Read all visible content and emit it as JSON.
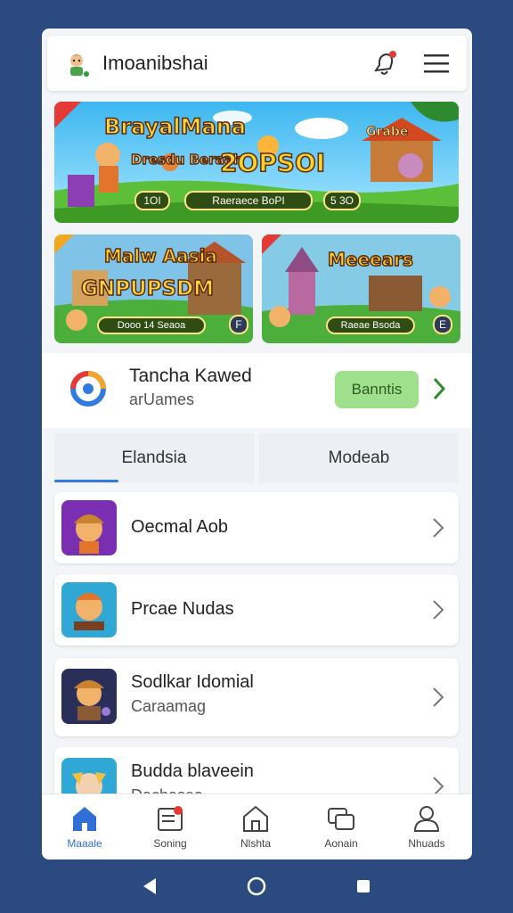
{
  "header": {
    "title": "Imoanibshai",
    "logo_icon": "character-logo-icon",
    "notification_icon": "bell-icon",
    "menu_icon": "hamburger-menu-icon"
  },
  "banner": {
    "title": "BrayalMana",
    "subtitle": "Dresdu Beraah",
    "big_text": "2OPSOI",
    "pill_left": "1OI",
    "pill_mid": "Raeraece BoPI",
    "pill_right": "5 3O",
    "sign": "Grabe"
  },
  "cards": [
    {
      "title": "Malw Aasia",
      "big_text": "GNPUPSDM",
      "pill": "Dooo  14 Seaoa",
      "badge": "F"
    },
    {
      "title": "Meeears",
      "pill": "Raeae Bsoda",
      "badge": "E"
    }
  ],
  "account": {
    "name": "Tancha Kawed",
    "sub": "arUames",
    "button_label": "Banntis"
  },
  "tabs": [
    {
      "label": "Elandsia",
      "active": true
    },
    {
      "label": "Modeab",
      "active": false
    }
  ],
  "list": [
    {
      "title": "Oecmal Aob",
      "sub": ""
    },
    {
      "title": "Prcae Nudas",
      "sub": ""
    },
    {
      "title": "Sodlkar Idomial",
      "sub": "Caraamag"
    },
    {
      "title": "Budda blaveein",
      "sub": "Dachasea"
    }
  ],
  "nav": [
    {
      "label": "Maaale",
      "icon": "home-icon",
      "active": true
    },
    {
      "label": "Soning",
      "icon": "notes-icon",
      "active": false
    },
    {
      "label": "Nlshta",
      "icon": "house-outline-icon",
      "active": false
    },
    {
      "label": "Aonain",
      "icon": "chat-icon",
      "active": false
    },
    {
      "label": "Nhuads",
      "icon": "user-icon",
      "active": false
    }
  ],
  "colors": {
    "accent": "#2f6fd6",
    "background": "#2b4a7f",
    "button_green": "#9fe08c"
  }
}
